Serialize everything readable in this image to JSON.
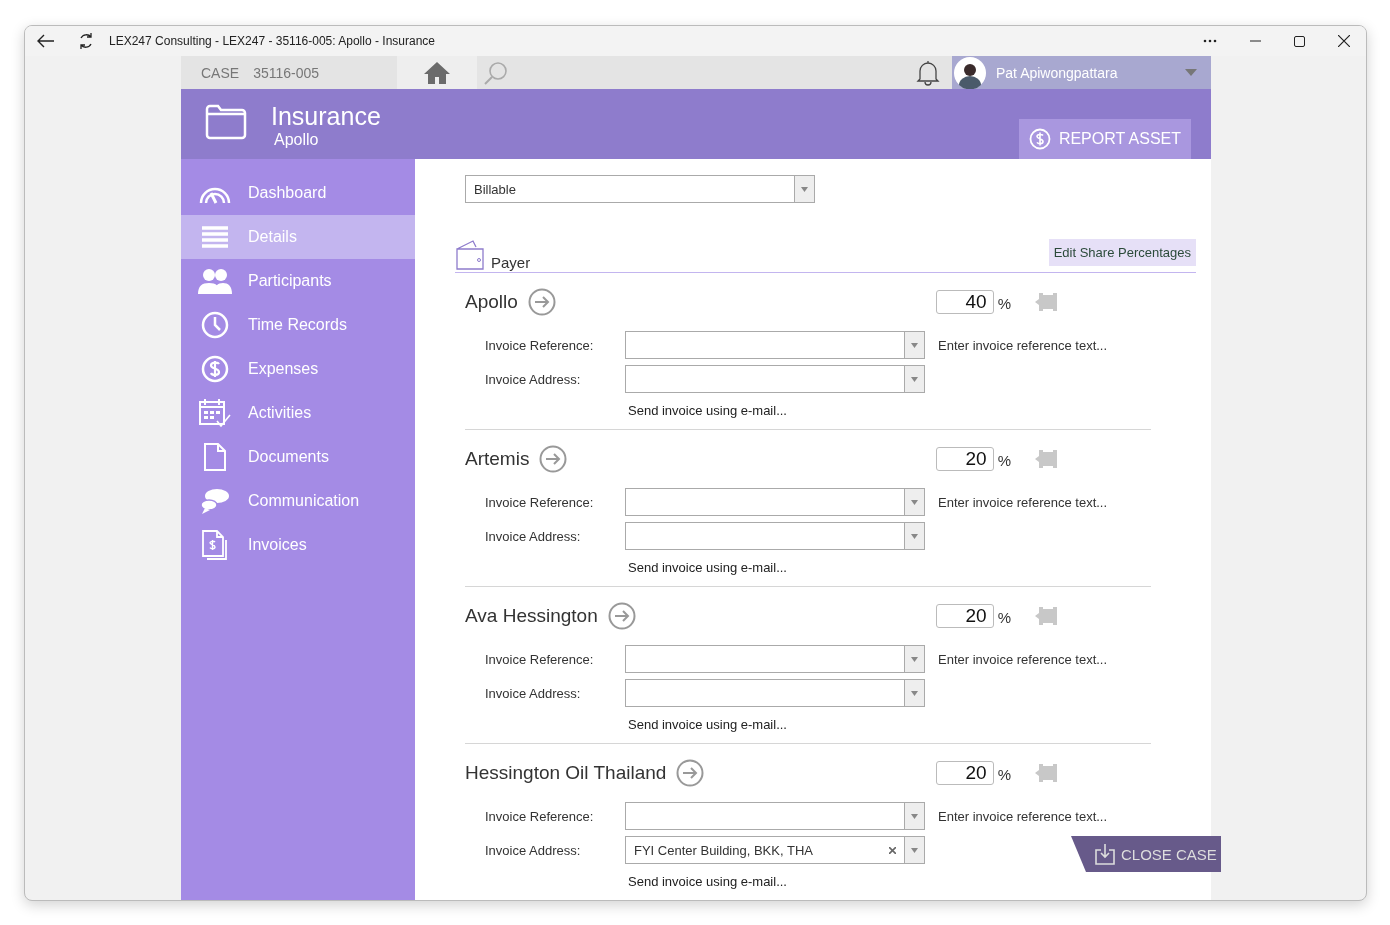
{
  "window": {
    "title": "LEX247 Consulting - LEX247 - 35116-005: Apollo - Insurance"
  },
  "case_bar": {
    "label": "CASE",
    "number": "35116-005"
  },
  "user": {
    "name": "Pat Apiwongpattara"
  },
  "header": {
    "title": "Insurance",
    "subtitle": "Apollo",
    "action": "REPORT ASSET"
  },
  "sidebar": {
    "items": [
      {
        "label": "Dashboard",
        "kind": "gauge",
        "selected": false
      },
      {
        "label": "Details",
        "kind": "lines",
        "selected": true
      },
      {
        "label": "Participants",
        "kind": "people",
        "selected": false
      },
      {
        "label": "Time Records",
        "kind": "clock",
        "selected": false
      },
      {
        "label": "Expenses",
        "kind": "dollar",
        "selected": false
      },
      {
        "label": "Activities",
        "kind": "calendar",
        "selected": false
      },
      {
        "label": "Documents",
        "kind": "page",
        "selected": false
      },
      {
        "label": "Communication",
        "kind": "chat",
        "selected": false
      },
      {
        "label": "Invoices",
        "kind": "invoice",
        "selected": false
      }
    ]
  },
  "billing": {
    "value": "Billable"
  },
  "payers_section": {
    "title": "Payer",
    "action": "Edit Share Percentages",
    "payers": [
      {
        "name": "Apollo",
        "share": "40",
        "percent_sign": "%",
        "reference_label": "Invoice Reference:",
        "reference_hint": "Enter invoice reference text...",
        "address_label": "Invoice Address:",
        "email_link": "Send invoice using e-mail..."
      },
      {
        "name": "Artemis",
        "share": "20",
        "percent_sign": "%",
        "reference_label": "Invoice Reference:",
        "reference_hint": "Enter invoice reference text...",
        "address_label": "Invoice Address:",
        "email_link": "Send invoice using e-mail..."
      },
      {
        "name": "Ava Hessington",
        "share": "20",
        "percent_sign": "%",
        "reference_label": "Invoice Reference:",
        "reference_hint": "Enter invoice reference text...",
        "address_label": "Invoice Address:",
        "email_link": "Send invoice using e-mail..."
      },
      {
        "name": "Hessington Oil Thailand",
        "share": "20",
        "percent_sign": "%",
        "reference_label": "Invoice Reference:",
        "reference_hint": "Enter invoice reference text...",
        "address_label": "Invoice Address:",
        "address_value": "FYI Center Building, BKK, THA",
        "email_link": "Send invoice using e-mail..."
      }
    ]
  },
  "close_action": {
    "label": "CLOSE CASE"
  }
}
